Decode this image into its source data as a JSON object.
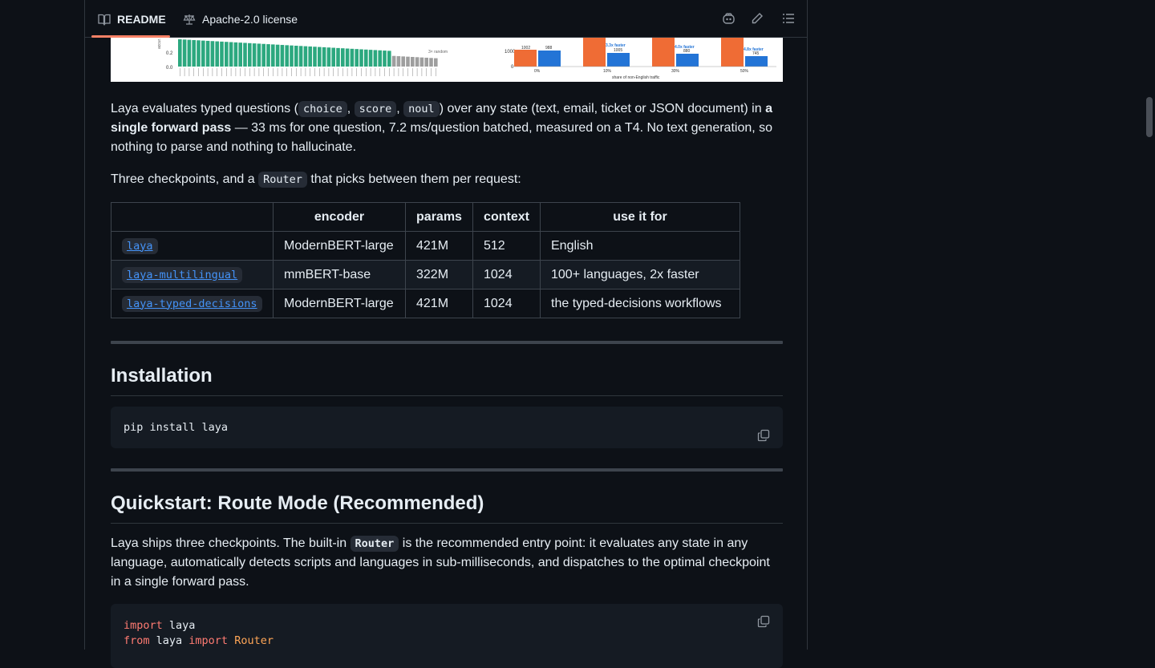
{
  "tabs": {
    "readme": "README",
    "license": "Apache-2.0 license"
  },
  "intro": {
    "p1_a": "Laya evaluates typed questions (",
    "code_choice": "choice",
    "comma1": ",",
    "code_score": "score",
    "comma2": ",",
    "code_noul": "noul",
    "p1_b": ") over any state (text, email, ticket or JSON document) in ",
    "p1_bold": "a single forward pass",
    "p1_c": " — 33 ms for one question, 7.2 ms/question batched, measured on a T4. No text generation, so nothing to parse and nothing to hallucinate.",
    "p2_a": "Three checkpoints, and a ",
    "code_router": "Router",
    "p2_b": " that picks between them per request:"
  },
  "models_table": {
    "headers": [
      "",
      "encoder",
      "params",
      "context",
      "use it for"
    ],
    "rows": [
      {
        "name": "laya",
        "encoder": "ModernBERT-large",
        "params": "421M",
        "context": "512",
        "use": "English"
      },
      {
        "name": "laya-multilingual",
        "encoder": "mmBERT-base",
        "params": "322M",
        "context": "1024",
        "use": "100+ languages, 2x faster"
      },
      {
        "name": "laya-typed-decisions",
        "encoder": "ModernBERT-large",
        "params": "421M",
        "context": "1024",
        "use": "the typed-decisions workflows"
      }
    ]
  },
  "installation": {
    "heading": "Installation",
    "code": "pip install laya"
  },
  "quickstart": {
    "heading": "Quickstart: Route Mode (Recommended)",
    "p_a": "Laya ships three checkpoints. The built-in ",
    "code_router": "Router",
    "p_b": " is the recommended entry point: it evaluates any state in any language, automatically detects scripts and languages in sub-milliseconds, and dispatches to the optimal checkpoint in a single forward pass.",
    "line1_kw": "import",
    "line1_rest": " laya",
    "line2_kw1": "from",
    "line2_mid": " laya ",
    "line2_kw2": "import",
    "line2_cls": " Router"
  },
  "chart_strip": {
    "ylabel_ticks": [
      "0.2",
      "0.0"
    ],
    "annotation_random": "3× random",
    "bar_labels": [
      "1002",
      "988",
      "1005",
      "880",
      "745"
    ],
    "speed_labels": [
      "3.3x faster",
      "4.0x faster",
      "4.8x faster"
    ],
    "x_ticks": [
      "0%",
      "10%",
      "30%",
      "50%"
    ],
    "xlabel": "share of non-English traffic",
    "y_ticks_right": [
      "1000",
      "0"
    ],
    "colors": {
      "green": "#2ca87f",
      "grey": "#9e9e9e",
      "orange": "#ef6c35",
      "blue": "#2374d6"
    }
  }
}
